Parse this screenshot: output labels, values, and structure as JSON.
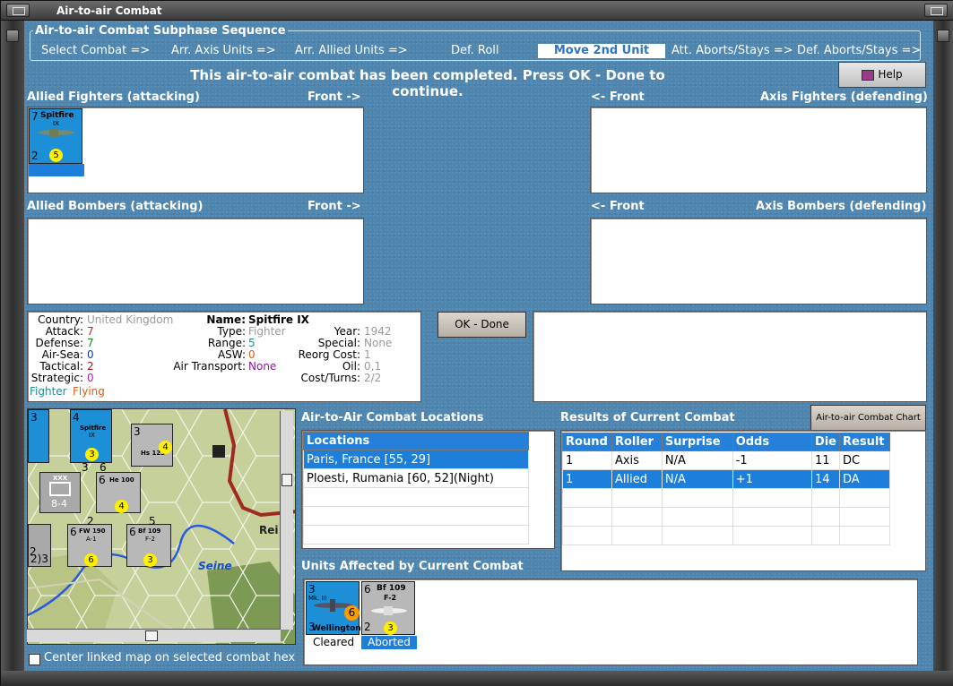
{
  "window": {
    "title": "Air-to-air Combat"
  },
  "sequence": {
    "title": "Air-to-air Combat Subphase Sequence",
    "steps": [
      "Select Combat =>",
      "Arr. Axis Units =>",
      "Arr. Allied Units =>",
      "Def. Roll",
      "Move 2nd Unit",
      "Att. Aborts/Stays =>",
      "Def. Aborts/Stays =>"
    ],
    "active_step": "Move 2nd Unit"
  },
  "message": "This air-to-air combat has been completed.  Press OK - Done to continue.",
  "help_label": "Help",
  "panels": {
    "allied_fighters": "Allied Fighters (attacking)",
    "axis_fighters": "Axis Fighters (defending)",
    "allied_bombers": "Allied Bombers (attacking)",
    "axis_bombers": "Axis Bombers (defending)",
    "front_right": "Front ->",
    "front_left": "<- Front"
  },
  "allied_fighter_counter": {
    "name": "Spitfire",
    "sub": "IX",
    "attack": "7",
    "defense": "2",
    "range": "5"
  },
  "unit_info": {
    "country_label": "Country:",
    "country": "United Kingdom",
    "attack_label": "Attack:",
    "attack": "7",
    "defense_label": "Defense:",
    "defense": "7",
    "airsea_label": "Air-Sea:",
    "airsea": "0",
    "tactical_label": "Tactical:",
    "tactical": "2",
    "strategic_label": "Strategic:",
    "strategic": "0",
    "fighter": "Fighter",
    "flying": "Flying",
    "name_label": "Name:",
    "name": "Spitfire IX",
    "type_label": "Type:",
    "type": "Fighter",
    "range_label": "Range:",
    "range": "5",
    "asw_label": "ASW:",
    "asw": "0",
    "airtransport_label": "Air Transport:",
    "airtransport": "None",
    "year_label": "Year:",
    "year": "1942",
    "special_label": "Special:",
    "special": "None",
    "reorg_label": "Reorg Cost:",
    "reorg": "1",
    "oil_label": "Oil:",
    "oil": "0,1",
    "cost_label": "Cost/Turns:",
    "cost": "2/2"
  },
  "ok_done_label": "OK - Done",
  "map": {
    "river": "Seine",
    "town": "Rei",
    "counters": [
      {
        "name": "Spitfire",
        "sub": "IX",
        "top": "4",
        "bottom": "3"
      },
      {
        "name": "Hs 123",
        "top": "3",
        "bottom": "4"
      },
      {
        "name": "He 100",
        "top": "6",
        "bottom": "4"
      },
      {
        "name": "FW 190",
        "sub": "A-1",
        "top": "6",
        "bottom": "6"
      },
      {
        "name": "Bf 109",
        "sub": "F-2",
        "top": "6",
        "bottom": "3"
      },
      {
        "name": "XXX",
        "value": "8-4"
      }
    ],
    "fragments": [
      "2",
      "3",
      "2)3",
      "6",
      "3",
      "5",
      "2"
    ],
    "center_label": "Center linked map on selected combat hex"
  },
  "locations": {
    "title": "Air-to-Air Combat Locations",
    "header": "Locations",
    "rows": [
      "Paris, France [55, 29]",
      "Ploesti, Rumania [60, 52](Night)"
    ],
    "selected": 0
  },
  "results": {
    "title": "Results of Current Combat",
    "chart_button": "Air-to-air Combat Chart",
    "columns": [
      "Round",
      "Roller",
      "Surprise",
      "Odds",
      "Die",
      "Result"
    ],
    "rows": [
      [
        "1",
        "Axis",
        "N/A",
        "-1",
        "11",
        "DC"
      ],
      [
        "1",
        "Allied",
        "N/A",
        "+1",
        "14",
        "DA"
      ]
    ],
    "selected": 1
  },
  "units_affected": {
    "title": "Units Affected by Current Combat",
    "units": [
      {
        "name": "Wellington",
        "sub": "Mk. III",
        "top": "3",
        "bottom": "3",
        "value": "6",
        "status": "Cleared"
      },
      {
        "name": "Bf 109",
        "sub": "F-2",
        "top": "6",
        "bottom": "2",
        "value": "3",
        "status": "Aborted"
      }
    ]
  },
  "colors": {
    "background": "#4f86b0",
    "selection": "#1d7fd9",
    "allied_counter": "#1d8fd6",
    "axis_counter": "#b8b8b8"
  }
}
